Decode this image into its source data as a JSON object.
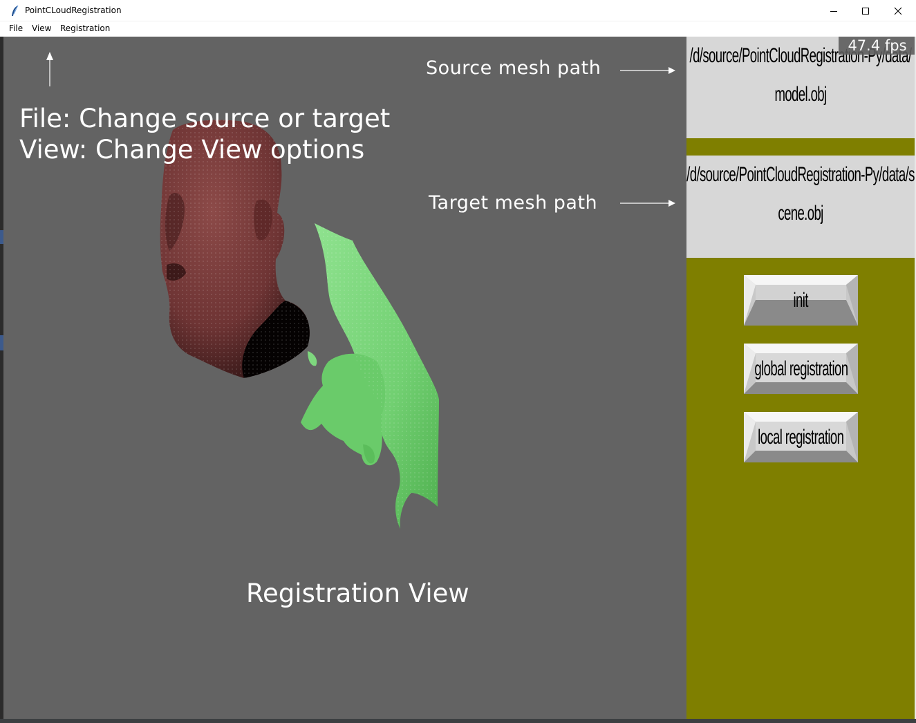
{
  "window": {
    "title": "PointCLoudRegistration",
    "controls": [
      "minimize",
      "maximize",
      "close"
    ]
  },
  "menu": {
    "items": [
      "File",
      "View",
      "Registration"
    ]
  },
  "viewport": {
    "fps": "47.4 fps",
    "annotations": {
      "menu_note_line1": "File: Change source or target",
      "menu_note_line2": "View: Change View options",
      "source_label": "Source mesh path",
      "target_label": "Target mesh path",
      "view_label": "Registration View"
    },
    "colors": {
      "background": "#636363",
      "source_mesh": "#7a3a3a",
      "target_mesh": "#7ed87e"
    }
  },
  "panel": {
    "background": "#7f7f00",
    "source_path": "/d/source/PointCloudRegistration-Py/data/model.obj",
    "target_path": "/d/source/PointCloudRegistration-Py/data/scene.obj",
    "buttons": {
      "init": "init",
      "global": "global registration",
      "local": "local registration"
    }
  }
}
